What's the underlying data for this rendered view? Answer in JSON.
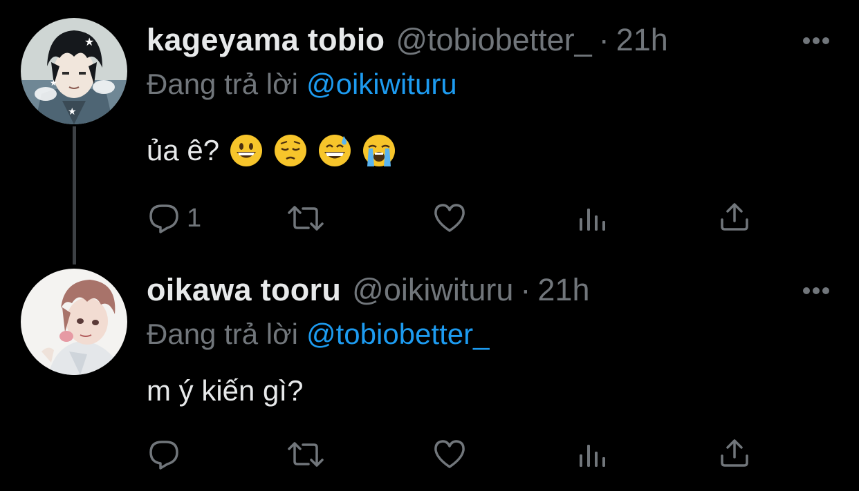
{
  "theme": {
    "background": "#000000",
    "name_color": "#e7e9ea",
    "muted_color": "#71767b",
    "link_color": "#1d9bf0",
    "thread_line_color": "#3d4145"
  },
  "tweets": [
    {
      "display_name": "kageyama tobio",
      "handle": "@tobiobetter_",
      "separator": "·",
      "time": "21h",
      "replying_prefix": "Đang trả lời",
      "replying_to": "@oikiwituru",
      "text": "ủa ê?",
      "emojis": [
        "grinning-face",
        "pensive-face",
        "grinning-face-with-sweat",
        "loudly-crying-face"
      ],
      "avatar_icon": "avatar-kageyama",
      "actions": {
        "reply_count": "1",
        "retweet_count": "",
        "like_count": ""
      }
    },
    {
      "display_name": "oikawa tooru",
      "handle": "@oikiwituru",
      "separator": "·",
      "time": "21h",
      "replying_prefix": "Đang trả lời",
      "replying_to": "@tobiobetter_",
      "text": "m ý kiến gì?",
      "emojis": [],
      "avatar_icon": "avatar-oikawa",
      "actions": {
        "reply_count": "",
        "retweet_count": "",
        "like_count": ""
      }
    }
  ]
}
